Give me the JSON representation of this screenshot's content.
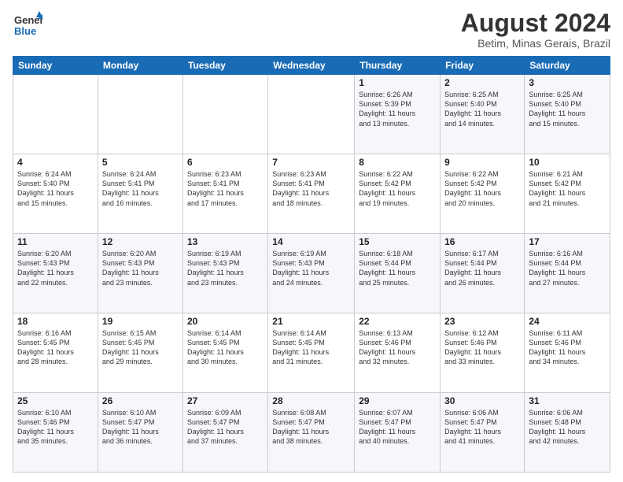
{
  "header": {
    "logo_general": "General",
    "logo_blue": "Blue",
    "month_year": "August 2024",
    "location": "Betim, Minas Gerais, Brazil"
  },
  "weekdays": [
    "Sunday",
    "Monday",
    "Tuesday",
    "Wednesday",
    "Thursday",
    "Friday",
    "Saturday"
  ],
  "weeks": [
    [
      {
        "day": "",
        "info": ""
      },
      {
        "day": "",
        "info": ""
      },
      {
        "day": "",
        "info": ""
      },
      {
        "day": "",
        "info": ""
      },
      {
        "day": "1",
        "info": "Sunrise: 6:26 AM\nSunset: 5:39 PM\nDaylight: 11 hours\nand 13 minutes."
      },
      {
        "day": "2",
        "info": "Sunrise: 6:25 AM\nSunset: 5:40 PM\nDaylight: 11 hours\nand 14 minutes."
      },
      {
        "day": "3",
        "info": "Sunrise: 6:25 AM\nSunset: 5:40 PM\nDaylight: 11 hours\nand 15 minutes."
      }
    ],
    [
      {
        "day": "4",
        "info": "Sunrise: 6:24 AM\nSunset: 5:40 PM\nDaylight: 11 hours\nand 15 minutes."
      },
      {
        "day": "5",
        "info": "Sunrise: 6:24 AM\nSunset: 5:41 PM\nDaylight: 11 hours\nand 16 minutes."
      },
      {
        "day": "6",
        "info": "Sunrise: 6:23 AM\nSunset: 5:41 PM\nDaylight: 11 hours\nand 17 minutes."
      },
      {
        "day": "7",
        "info": "Sunrise: 6:23 AM\nSunset: 5:41 PM\nDaylight: 11 hours\nand 18 minutes."
      },
      {
        "day": "8",
        "info": "Sunrise: 6:22 AM\nSunset: 5:42 PM\nDaylight: 11 hours\nand 19 minutes."
      },
      {
        "day": "9",
        "info": "Sunrise: 6:22 AM\nSunset: 5:42 PM\nDaylight: 11 hours\nand 20 minutes."
      },
      {
        "day": "10",
        "info": "Sunrise: 6:21 AM\nSunset: 5:42 PM\nDaylight: 11 hours\nand 21 minutes."
      }
    ],
    [
      {
        "day": "11",
        "info": "Sunrise: 6:20 AM\nSunset: 5:43 PM\nDaylight: 11 hours\nand 22 minutes."
      },
      {
        "day": "12",
        "info": "Sunrise: 6:20 AM\nSunset: 5:43 PM\nDaylight: 11 hours\nand 23 minutes."
      },
      {
        "day": "13",
        "info": "Sunrise: 6:19 AM\nSunset: 5:43 PM\nDaylight: 11 hours\nand 23 minutes."
      },
      {
        "day": "14",
        "info": "Sunrise: 6:19 AM\nSunset: 5:43 PM\nDaylight: 11 hours\nand 24 minutes."
      },
      {
        "day": "15",
        "info": "Sunrise: 6:18 AM\nSunset: 5:44 PM\nDaylight: 11 hours\nand 25 minutes."
      },
      {
        "day": "16",
        "info": "Sunrise: 6:17 AM\nSunset: 5:44 PM\nDaylight: 11 hours\nand 26 minutes."
      },
      {
        "day": "17",
        "info": "Sunrise: 6:16 AM\nSunset: 5:44 PM\nDaylight: 11 hours\nand 27 minutes."
      }
    ],
    [
      {
        "day": "18",
        "info": "Sunrise: 6:16 AM\nSunset: 5:45 PM\nDaylight: 11 hours\nand 28 minutes."
      },
      {
        "day": "19",
        "info": "Sunrise: 6:15 AM\nSunset: 5:45 PM\nDaylight: 11 hours\nand 29 minutes."
      },
      {
        "day": "20",
        "info": "Sunrise: 6:14 AM\nSunset: 5:45 PM\nDaylight: 11 hours\nand 30 minutes."
      },
      {
        "day": "21",
        "info": "Sunrise: 6:14 AM\nSunset: 5:45 PM\nDaylight: 11 hours\nand 31 minutes."
      },
      {
        "day": "22",
        "info": "Sunrise: 6:13 AM\nSunset: 5:46 PM\nDaylight: 11 hours\nand 32 minutes."
      },
      {
        "day": "23",
        "info": "Sunrise: 6:12 AM\nSunset: 5:46 PM\nDaylight: 11 hours\nand 33 minutes."
      },
      {
        "day": "24",
        "info": "Sunrise: 6:11 AM\nSunset: 5:46 PM\nDaylight: 11 hours\nand 34 minutes."
      }
    ],
    [
      {
        "day": "25",
        "info": "Sunrise: 6:10 AM\nSunset: 5:46 PM\nDaylight: 11 hours\nand 35 minutes."
      },
      {
        "day": "26",
        "info": "Sunrise: 6:10 AM\nSunset: 5:47 PM\nDaylight: 11 hours\nand 36 minutes."
      },
      {
        "day": "27",
        "info": "Sunrise: 6:09 AM\nSunset: 5:47 PM\nDaylight: 11 hours\nand 37 minutes."
      },
      {
        "day": "28",
        "info": "Sunrise: 6:08 AM\nSunset: 5:47 PM\nDaylight: 11 hours\nand 38 minutes."
      },
      {
        "day": "29",
        "info": "Sunrise: 6:07 AM\nSunset: 5:47 PM\nDaylight: 11 hours\nand 40 minutes."
      },
      {
        "day": "30",
        "info": "Sunrise: 6:06 AM\nSunset: 5:47 PM\nDaylight: 11 hours\nand 41 minutes."
      },
      {
        "day": "31",
        "info": "Sunrise: 6:06 AM\nSunset: 5:48 PM\nDaylight: 11 hours\nand 42 minutes."
      }
    ]
  ]
}
